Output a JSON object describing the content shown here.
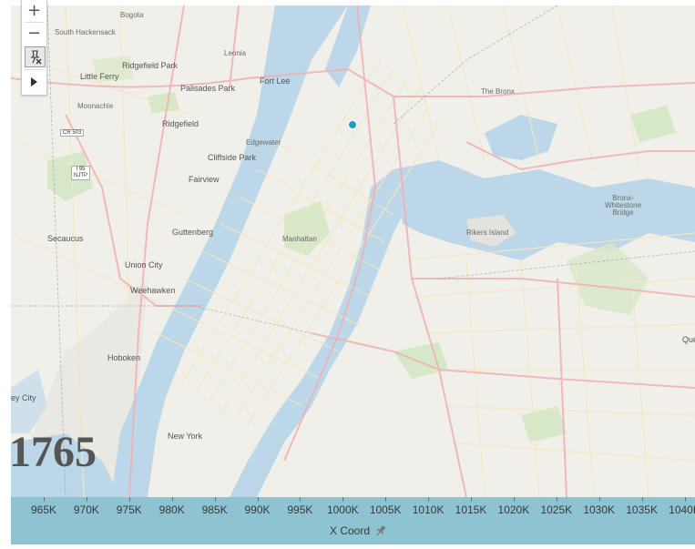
{
  "colors": {
    "axis_bg": "#8ec3d2",
    "point": "#1f9ec4",
    "water": "#bcd7e8",
    "land": "#f1efe9",
    "park": "#d6e8c8",
    "road_major": "#efb0b4",
    "road_minor": "#f5e6bf"
  },
  "toolbar": {
    "zoom_in_icon": "plus-icon",
    "zoom_out_icon": "minus-icon",
    "pin_icon": "unpin-map-icon",
    "play_icon": "play-icon"
  },
  "map": {
    "labels": {
      "bogota": "Bogota",
      "south_hackensack": "South Hackensack",
      "ridgefield_park": "Ridgefield Park",
      "little_ferry": "Little Ferry",
      "moonachie": "Moonachie",
      "palisades_park": "Palisades Park",
      "fort_lee": "Fort Lee",
      "leonia": "Leonia",
      "ridgefield": "Ridgefield",
      "edgewater": "Edgewater",
      "cliffside_park": "Cliffside Park",
      "fairview": "Fairview",
      "secaucus": "Secaucus",
      "guttenberg": "Guttenberg",
      "union_city": "Union City",
      "weehawken": "Weehawken",
      "hoboken": "Hoboken",
      "jersey_city": "ey City",
      "new_york": "New York",
      "manhattan": "Manhattan",
      "the_bronx": "The Bronx",
      "rikers_island": "Rikers Island",
      "bronx_whitestone": "Bronx-\nWhitestone\nBridge",
      "queens_edge": "Que",
      "shield_cr503": "CR 503",
      "shield_i95": "I 95\nNJTP"
    },
    "points": [
      {
        "id": "p1",
        "label": "point"
      }
    ]
  },
  "big_number": "1765",
  "x_axis": {
    "title": "X Coord",
    "ticks": [
      "965K",
      "970K",
      "975K",
      "980K",
      "985K",
      "990K",
      "995K",
      "1000K",
      "1005K",
      "1010K",
      "1015K",
      "1020K",
      "1025K",
      "1030K",
      "1035K",
      "1040K"
    ]
  }
}
